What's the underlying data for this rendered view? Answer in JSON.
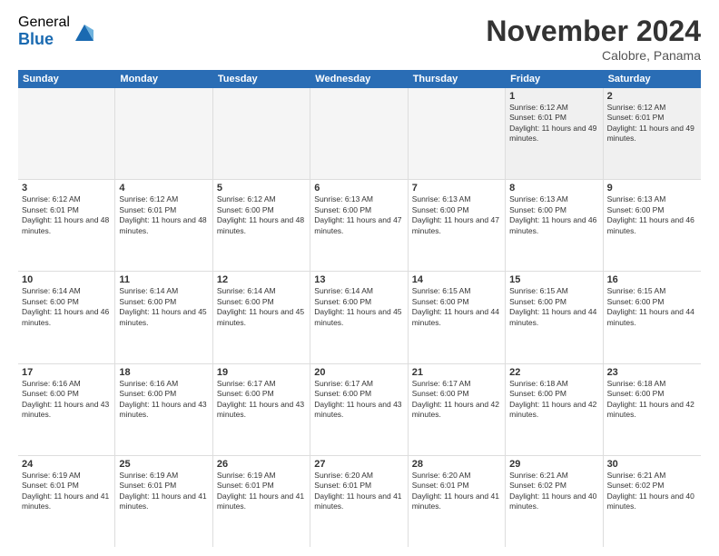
{
  "logo": {
    "general": "General",
    "blue": "Blue"
  },
  "title": "November 2024",
  "subtitle": "Calobre, Panama",
  "header_days": [
    "Sunday",
    "Monday",
    "Tuesday",
    "Wednesday",
    "Thursday",
    "Friday",
    "Saturday"
  ],
  "rows": [
    [
      {
        "day": "",
        "empty": true
      },
      {
        "day": "",
        "empty": true
      },
      {
        "day": "",
        "empty": true
      },
      {
        "day": "",
        "empty": true
      },
      {
        "day": "",
        "empty": true
      },
      {
        "day": "1",
        "rise": "Sunrise: 6:12 AM",
        "set": "Sunset: 6:01 PM",
        "day_detail": "Daylight: 11 hours and 49 minutes."
      },
      {
        "day": "2",
        "rise": "Sunrise: 6:12 AM",
        "set": "Sunset: 6:01 PM",
        "day_detail": "Daylight: 11 hours and 49 minutes."
      }
    ],
    [
      {
        "day": "3",
        "rise": "Sunrise: 6:12 AM",
        "set": "Sunset: 6:01 PM",
        "day_detail": "Daylight: 11 hours and 48 minutes."
      },
      {
        "day": "4",
        "rise": "Sunrise: 6:12 AM",
        "set": "Sunset: 6:01 PM",
        "day_detail": "Daylight: 11 hours and 48 minutes."
      },
      {
        "day": "5",
        "rise": "Sunrise: 6:12 AM",
        "set": "Sunset: 6:00 PM",
        "day_detail": "Daylight: 11 hours and 48 minutes."
      },
      {
        "day": "6",
        "rise": "Sunrise: 6:13 AM",
        "set": "Sunset: 6:00 PM",
        "day_detail": "Daylight: 11 hours and 47 minutes."
      },
      {
        "day": "7",
        "rise": "Sunrise: 6:13 AM",
        "set": "Sunset: 6:00 PM",
        "day_detail": "Daylight: 11 hours and 47 minutes."
      },
      {
        "day": "8",
        "rise": "Sunrise: 6:13 AM",
        "set": "Sunset: 6:00 PM",
        "day_detail": "Daylight: 11 hours and 46 minutes."
      },
      {
        "day": "9",
        "rise": "Sunrise: 6:13 AM",
        "set": "Sunset: 6:00 PM",
        "day_detail": "Daylight: 11 hours and 46 minutes."
      }
    ],
    [
      {
        "day": "10",
        "rise": "Sunrise: 6:14 AM",
        "set": "Sunset: 6:00 PM",
        "day_detail": "Daylight: 11 hours and 46 minutes."
      },
      {
        "day": "11",
        "rise": "Sunrise: 6:14 AM",
        "set": "Sunset: 6:00 PM",
        "day_detail": "Daylight: 11 hours and 45 minutes."
      },
      {
        "day": "12",
        "rise": "Sunrise: 6:14 AM",
        "set": "Sunset: 6:00 PM",
        "day_detail": "Daylight: 11 hours and 45 minutes."
      },
      {
        "day": "13",
        "rise": "Sunrise: 6:14 AM",
        "set": "Sunset: 6:00 PM",
        "day_detail": "Daylight: 11 hours and 45 minutes."
      },
      {
        "day": "14",
        "rise": "Sunrise: 6:15 AM",
        "set": "Sunset: 6:00 PM",
        "day_detail": "Daylight: 11 hours and 44 minutes."
      },
      {
        "day": "15",
        "rise": "Sunrise: 6:15 AM",
        "set": "Sunset: 6:00 PM",
        "day_detail": "Daylight: 11 hours and 44 minutes."
      },
      {
        "day": "16",
        "rise": "Sunrise: 6:15 AM",
        "set": "Sunset: 6:00 PM",
        "day_detail": "Daylight: 11 hours and 44 minutes."
      }
    ],
    [
      {
        "day": "17",
        "rise": "Sunrise: 6:16 AM",
        "set": "Sunset: 6:00 PM",
        "day_detail": "Daylight: 11 hours and 43 minutes."
      },
      {
        "day": "18",
        "rise": "Sunrise: 6:16 AM",
        "set": "Sunset: 6:00 PM",
        "day_detail": "Daylight: 11 hours and 43 minutes."
      },
      {
        "day": "19",
        "rise": "Sunrise: 6:17 AM",
        "set": "Sunset: 6:00 PM",
        "day_detail": "Daylight: 11 hours and 43 minutes."
      },
      {
        "day": "20",
        "rise": "Sunrise: 6:17 AM",
        "set": "Sunset: 6:00 PM",
        "day_detail": "Daylight: 11 hours and 43 minutes."
      },
      {
        "day": "21",
        "rise": "Sunrise: 6:17 AM",
        "set": "Sunset: 6:00 PM",
        "day_detail": "Daylight: 11 hours and 42 minutes."
      },
      {
        "day": "22",
        "rise": "Sunrise: 6:18 AM",
        "set": "Sunset: 6:00 PM",
        "day_detail": "Daylight: 11 hours and 42 minutes."
      },
      {
        "day": "23",
        "rise": "Sunrise: 6:18 AM",
        "set": "Sunset: 6:00 PM",
        "day_detail": "Daylight: 11 hours and 42 minutes."
      }
    ],
    [
      {
        "day": "24",
        "rise": "Sunrise: 6:19 AM",
        "set": "Sunset: 6:01 PM",
        "day_detail": "Daylight: 11 hours and 41 minutes."
      },
      {
        "day": "25",
        "rise": "Sunrise: 6:19 AM",
        "set": "Sunset: 6:01 PM",
        "day_detail": "Daylight: 11 hours and 41 minutes."
      },
      {
        "day": "26",
        "rise": "Sunrise: 6:19 AM",
        "set": "Sunset: 6:01 PM",
        "day_detail": "Daylight: 11 hours and 41 minutes."
      },
      {
        "day": "27",
        "rise": "Sunrise: 6:20 AM",
        "set": "Sunset: 6:01 PM",
        "day_detail": "Daylight: 11 hours and 41 minutes."
      },
      {
        "day": "28",
        "rise": "Sunrise: 6:20 AM",
        "set": "Sunset: 6:01 PM",
        "day_detail": "Daylight: 11 hours and 41 minutes."
      },
      {
        "day": "29",
        "rise": "Sunrise: 6:21 AM",
        "set": "Sunset: 6:02 PM",
        "day_detail": "Daylight: 11 hours and 40 minutes."
      },
      {
        "day": "30",
        "rise": "Sunrise: 6:21 AM",
        "set": "Sunset: 6:02 PM",
        "day_detail": "Daylight: 11 hours and 40 minutes."
      }
    ]
  ]
}
